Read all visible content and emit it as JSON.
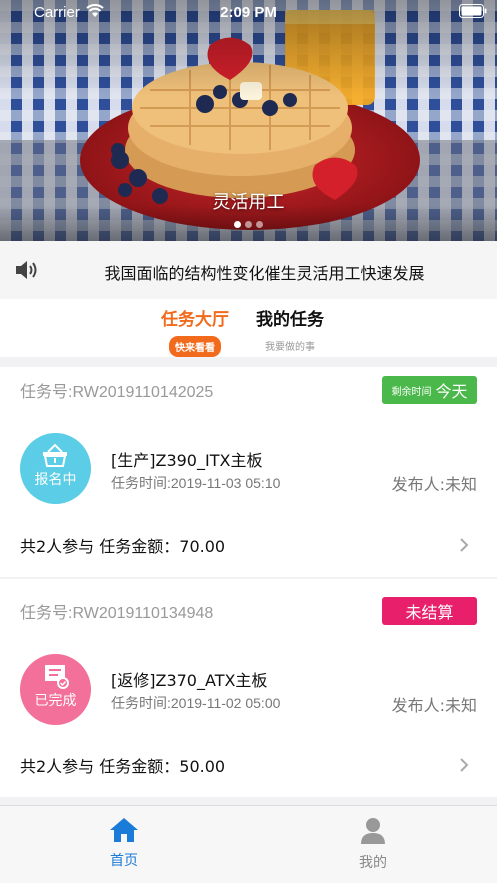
{
  "status_bar": {
    "carrier": "Carrier",
    "time": "2:09 PM"
  },
  "banner": {
    "caption": "灵活用工",
    "dots": 3,
    "active_dot": 0
  },
  "notice": {
    "icon": "speaker-icon",
    "text": "我国面临的结构性变化催生灵活用工快速发展"
  },
  "tabs": [
    {
      "label": "任务大厅",
      "sub": "快来看看",
      "active": true
    },
    {
      "label": "我的任务",
      "sub": "我要做的事",
      "active": false
    }
  ],
  "tasks": [
    {
      "task_no": "任务号:RW2019110142025",
      "badge_small": "剩余时间",
      "badge_big": "今天",
      "badge_color": "#4bb84b",
      "status_icon": "basket-icon",
      "status_label": "报名中",
      "status_color": "#5bcde7",
      "title": "[生产]Z390_ITX主板",
      "time": "任务时间:2019-11-03 05:10",
      "publisher": "发布人:未知",
      "summary": "共2人参与  任务金额：70.00"
    },
    {
      "task_no": "任务号:RW2019110134948",
      "badge": "未结算",
      "badge_color": "#e8206c",
      "status_icon": "certificate-icon",
      "status_label": "已完成",
      "status_color": "#f2709a",
      "title": "[返修]Z370_ATX主板",
      "time": "任务时间:2019-11-02 05:00",
      "publisher": "发布人:未知",
      "summary": "共2人参与  任务金额：50.00"
    }
  ],
  "tabbar": [
    {
      "label": "首页",
      "icon": "home-icon",
      "active": true
    },
    {
      "label": "我的",
      "icon": "person-icon",
      "active": false
    }
  ],
  "colors": {
    "accent_orange": "#f26a1b",
    "tab_active_blue": "#1a7bd9"
  }
}
